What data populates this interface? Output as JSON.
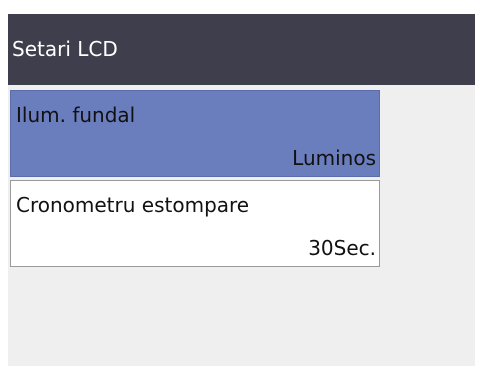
{
  "header": {
    "title": "Setari LCD"
  },
  "menu": {
    "items": [
      {
        "label": "Ilum. fundal",
        "value": "Luminos"
      },
      {
        "label": "Cronometru estompare",
        "value": "30Sec."
      }
    ]
  },
  "colors": {
    "title_bar": "#3e3e4c",
    "selected_item": "#6a7dbd",
    "background": "#efefef"
  }
}
